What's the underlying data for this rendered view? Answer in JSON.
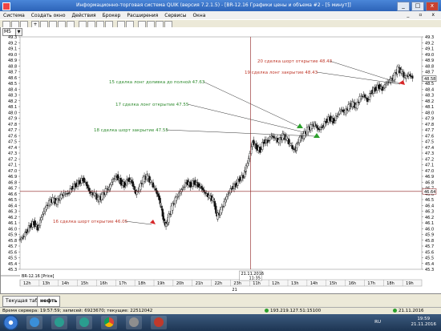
{
  "window": {
    "title": "Информационно-торговая система QUIK (версия 7.2.1.5) - [BR-12.16 Графики цены и объема #2 - [5 минут]]",
    "buttons": [
      "_",
      "□",
      "x"
    ]
  },
  "menu": {
    "items": [
      "Система",
      "Создать окно",
      "Действия",
      "Брокер",
      "Расширения",
      "Сервисы",
      "Окна"
    ],
    "mdi_buttons": [
      "_",
      "▫",
      "x"
    ]
  },
  "toolbar": {
    "timeframe": "M5",
    "arrow_label": "▼",
    "zoom_label": "+"
  },
  "chart_data": {
    "type": "candlestick",
    "instrument_label": "BR-12.16 [Price]",
    "ylim": [
      45.3,
      49.3
    ],
    "y_ticks": [
      "49.3",
      "49.2",
      "49.1",
      "49.0",
      "48.9",
      "48.8",
      "48.7",
      "48.6",
      "48.5",
      "48.4",
      "48.3",
      "48.2",
      "48.1",
      "48.0",
      "47.9",
      "47.8",
      "47.7",
      "47.6",
      "47.5",
      "47.4",
      "47.3",
      "47.2",
      "47.1",
      "47.0",
      "46.9",
      "46.8",
      "46.7",
      "46.6",
      "46.5",
      "46.4",
      "46.3",
      "46.2",
      "46.1",
      "46.0",
      "45.9",
      "45.8",
      "45.7",
      "45.6",
      "45.5",
      "45.4",
      "45.3"
    ],
    "x_ticks": [
      "12h",
      "13h",
      "14h",
      "15h",
      "16h",
      "17h",
      "18h",
      "19h",
      "20h",
      "21h",
      "22h",
      "23h",
      "11h",
      "12h",
      "13h",
      "14h",
      "15h",
      "16h",
      "17h",
      "18h",
      "19h"
    ],
    "date_tick": "21",
    "crosshair": {
      "date": "21.11.2016",
      "time": "11:35",
      "price": "46.64"
    },
    "last_price": "48.58",
    "price_path": [
      [
        0,
        45.8
      ],
      [
        4,
        45.85
      ],
      [
        8,
        45.95
      ],
      [
        12,
        46.05
      ],
      [
        16,
        46.1
      ],
      [
        20,
        46.0
      ],
      [
        24,
        46.2
      ],
      [
        28,
        46.35
      ],
      [
        32,
        46.45
      ],
      [
        36,
        46.5
      ],
      [
        40,
        46.45
      ],
      [
        44,
        46.55
      ],
      [
        48,
        46.6
      ],
      [
        52,
        46.6
      ],
      [
        56,
        46.7
      ],
      [
        60,
        46.75
      ],
      [
        64,
        46.8
      ],
      [
        68,
        46.85
      ],
      [
        72,
        46.75
      ],
      [
        76,
        46.6
      ],
      [
        80,
        46.6
      ],
      [
        84,
        46.5
      ],
      [
        88,
        46.55
      ],
      [
        92,
        46.65
      ],
      [
        96,
        46.7
      ],
      [
        100,
        46.85
      ],
      [
        104,
        46.9
      ],
      [
        108,
        46.8
      ],
      [
        112,
        46.75
      ],
      [
        116,
        46.85
      ],
      [
        120,
        46.8
      ],
      [
        124,
        46.6
      ],
      [
        128,
        46.7
      ],
      [
        132,
        46.85
      ],
      [
        136,
        46.9
      ],
      [
        140,
        46.8
      ],
      [
        144,
        46.7
      ],
      [
        148,
        46.55
      ],
      [
        150,
        46.4
      ],
      [
        152,
        46.25
      ],
      [
        155,
        46.05
      ],
      [
        158,
        46.15
      ],
      [
        162,
        46.35
      ],
      [
        166,
        46.5
      ],
      [
        170,
        46.6
      ],
      [
        174,
        46.7
      ],
      [
        178,
        46.8
      ],
      [
        182,
        46.75
      ],
      [
        186,
        46.8
      ],
      [
        190,
        46.75
      ],
      [
        194,
        46.7
      ],
      [
        198,
        46.6
      ],
      [
        202,
        46.55
      ],
      [
        206,
        46.5
      ],
      [
        208,
        46.35
      ],
      [
        210,
        46.2
      ],
      [
        214,
        46.3
      ],
      [
        218,
        46.45
      ],
      [
        222,
        46.6
      ],
      [
        226,
        46.7
      ],
      [
        230,
        46.75
      ],
      [
        234,
        46.85
      ],
      [
        238,
        46.9
      ],
      [
        240,
        47.0
      ],
      [
        244,
        47.2
      ],
      [
        248,
        47.5
      ],
      [
        252,
        47.4
      ],
      [
        256,
        47.35
      ],
      [
        260,
        47.5
      ],
      [
        264,
        47.5
      ],
      [
        268,
        47.6
      ],
      [
        272,
        47.55
      ],
      [
        276,
        47.5
      ],
      [
        280,
        47.6
      ],
      [
        284,
        47.55
      ],
      [
        288,
        47.45
      ],
      [
        292,
        47.35
      ],
      [
        294,
        47.4
      ],
      [
        298,
        47.55
      ],
      [
        302,
        47.6
      ],
      [
        306,
        47.7
      ],
      [
        310,
        47.75
      ],
      [
        314,
        47.8
      ],
      [
        318,
        47.7
      ],
      [
        322,
        47.75
      ],
      [
        326,
        47.85
      ],
      [
        330,
        47.9
      ],
      [
        334,
        47.85
      ],
      [
        338,
        47.95
      ],
      [
        342,
        48.05
      ],
      [
        346,
        48.0
      ],
      [
        350,
        48.1
      ],
      [
        354,
        48.15
      ],
      [
        358,
        48.1
      ],
      [
        362,
        48.25
      ],
      [
        366,
        48.3
      ],
      [
        370,
        48.2
      ],
      [
        374,
        48.35
      ],
      [
        378,
        48.4
      ],
      [
        382,
        48.45
      ],
      [
        386,
        48.4
      ],
      [
        390,
        48.5
      ],
      [
        394,
        48.55
      ],
      [
        398,
        48.6
      ],
      [
        402,
        48.75
      ],
      [
        406,
        48.7
      ],
      [
        410,
        48.6
      ],
      [
        414,
        48.65
      ],
      [
        418,
        48.6
      ]
    ],
    "annotations": [
      {
        "text": "20 сделка шорт открытие 48.43",
        "color": "#c0392b"
      },
      {
        "text": "19 сделка лонг закрытие 48.43",
        "color": "#c0392b"
      },
      {
        "text": "15 сделка лонг доливка до полной 47.63",
        "color": "#2e8b2e"
      },
      {
        "text": "17 сделка лонг открытие 47.55",
        "color": "#2e8b2e"
      },
      {
        "text": "18 сделка шорт закрытие 47.55",
        "color": "#2e8b2e"
      },
      {
        "text": "16 сделка шорт открытие 46.05",
        "color": "#c0392b"
      }
    ]
  },
  "tabs": [
    "Текущая таблица",
    "нефть"
  ],
  "status": {
    "server_time": "Время сервера: 19:57:59; записей: 6923670; текущие: 22512042",
    "connection": "193.219.127.51:15100",
    "date": "21.11.2016"
  },
  "taskbar": {
    "lang": "RU",
    "time": "19:59",
    "date": "21.11.2016"
  },
  "colors": {
    "buy": "#2ca02c",
    "sell": "#d62728",
    "crosshair": "#8b1c1c"
  }
}
